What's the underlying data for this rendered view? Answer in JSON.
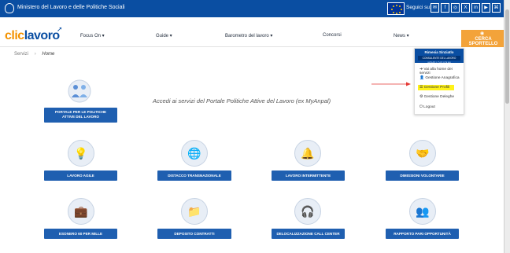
{
  "header": {
    "ministry": "Ministero del Lavoro e delle Politiche Sociali",
    "follow_label": "Seguici su:",
    "social": [
      "✉",
      "f",
      "◎",
      "X",
      "in",
      "▶",
      "⌘"
    ]
  },
  "nav": {
    "logo_part1": "clic",
    "logo_part2": "lavoro",
    "items": [
      "Focus On ▾",
      "Guide ▾",
      "Barometro del lavoro ▾",
      "Concorsi",
      "News ▾"
    ],
    "cerca": "CERCA SPORTELLO"
  },
  "breadcrumb": {
    "root": "Servizi",
    "current": "Home"
  },
  "user_menu": {
    "name": "Rimesia Sinziatlo",
    "role": "CONSULENTE DEL LAVORO NOVELLO ELIGIUM",
    "items": [
      "Vai alla home dei servizi",
      "Gestione Anagrafica",
      "Gestione Profili",
      "Gestione Deleghe",
      "Logout"
    ]
  },
  "intro": "Accedi ai servizi del Portale Politiche Attive del Lavoro (ex MyAnpal)",
  "services": {
    "portale_line1": "PORTALE PER LE POLITICHE",
    "portale_line2": "ATTIVE DEL LAVORO",
    "row1": [
      "LAVORO AGILE",
      "DISTACCO TRANSNAZIONALE",
      "LAVORO INTERMITTENTE",
      "DIMISSIONI VOLONTARIE"
    ],
    "row2": [
      "ESONERO 60 PER MILLE",
      "DEPOSITO CONTRATTI",
      "DELOCALIZZAZIONE CALL CENTER",
      "RAPPORTO PARI OPPORTUNITÀ"
    ]
  },
  "colors": {
    "primary": "#0a4ea2",
    "button": "#1f5fb0",
    "accent": "#f39200",
    "highlight": "#fff21a"
  }
}
